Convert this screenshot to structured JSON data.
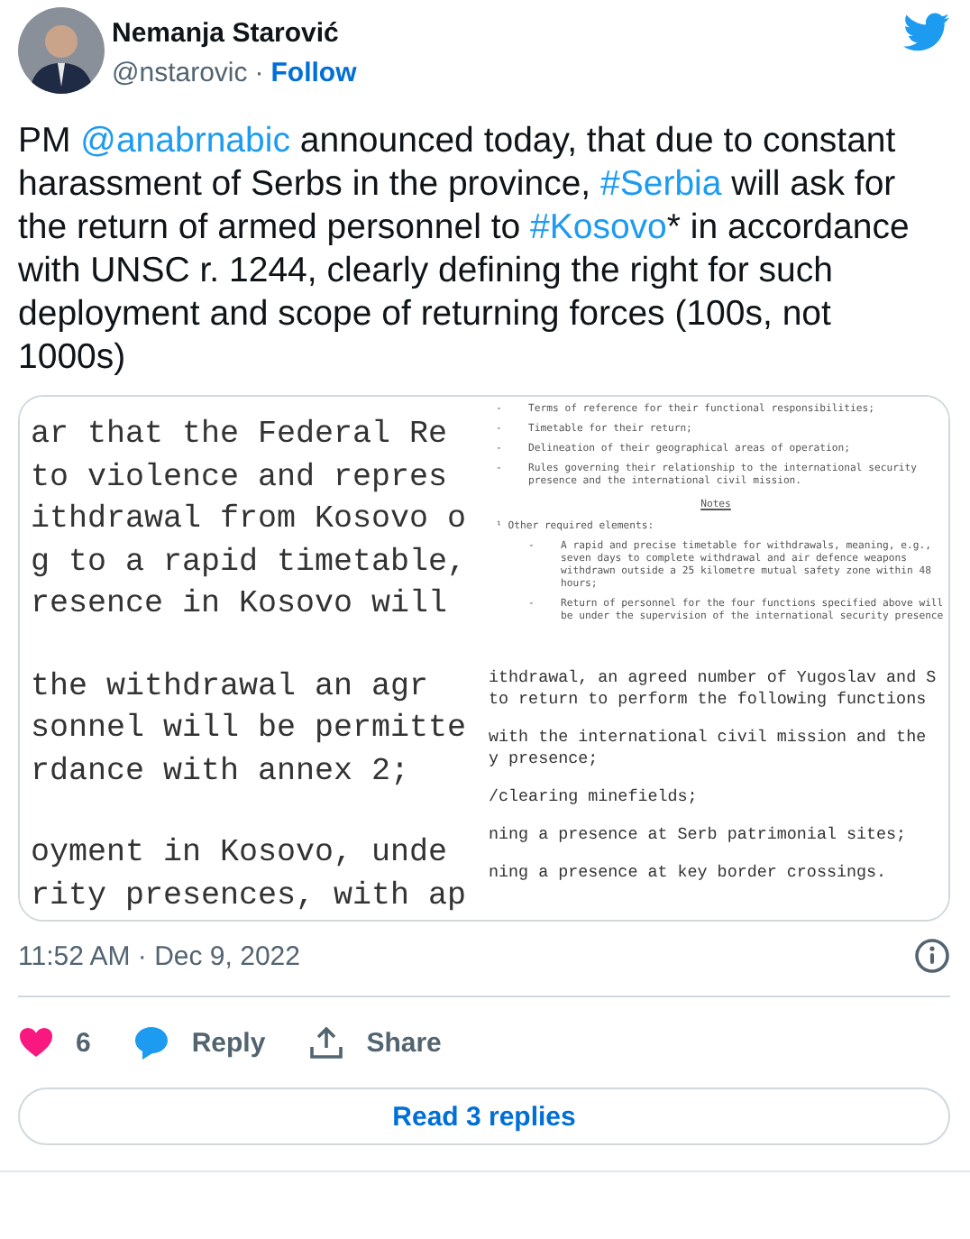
{
  "author": {
    "name": "Nemanja Starović",
    "handle": "@nstarovic",
    "separator": "·",
    "follow": "Follow"
  },
  "body": [
    {
      "kind": "text",
      "text": "PM "
    },
    {
      "kind": "link",
      "text": "@anabrnabic"
    },
    {
      "kind": "text",
      "text": " announced today, that due to constant harassment of Serbs in the province, "
    },
    {
      "kind": "link",
      "text": "#Serbia"
    },
    {
      "kind": "text",
      "text": " will ask for the return of armed personnel to "
    },
    {
      "kind": "link",
      "text": "#Kosovo"
    },
    {
      "kind": "text",
      "text": "* in accordance with UNSC r. 1244, clearly defining the right for such deployment and scope of returning forces (100s, not 1000s)"
    }
  ],
  "media": {
    "left": [
      [
        "ar that the Federal Re",
        "to violence and repres",
        "ithdrawal from Kosovo o",
        "g to a rapid timetable,",
        "resence in Kosovo will"
      ],
      [
        "the withdrawal an agr",
        "sonnel will be permitte",
        "rdance with annex 2;"
      ],
      [
        "oyment in Kosovo, unde",
        "rity presences, with ap"
      ]
    ],
    "right_top": [
      {
        "kind": "bullet",
        "marker": "-",
        "text": "Terms of reference for their functional responsibilities;"
      },
      {
        "kind": "bullet",
        "marker": "-",
        "text": "Timetable for their return;"
      },
      {
        "kind": "bullet",
        "marker": "-",
        "text": "Delineation of their geographical areas of operation;"
      },
      {
        "kind": "bullet",
        "marker": "-",
        "text": "Rules governing their relationship to the international security presence and the international civil mission."
      },
      {
        "kind": "heading",
        "text": "Notes"
      },
      {
        "kind": "text",
        "text": "¹ Other required elements:"
      },
      {
        "kind": "bullet",
        "marker": "-",
        "text": "A rapid and precise timetable for withdrawals, meaning, e.g., seven days to complete withdrawal and air defence weapons withdrawn outside a 25 kilometre mutual safety zone within 48 hours;"
      },
      {
        "kind": "bullet",
        "marker": "-",
        "text": "Return of personnel for the four functions specified above will be under the supervision of the international security presence"
      }
    ],
    "right_bottom": [
      [
        "ithdrawal, an agreed number of Yugoslav and S",
        "to return to perform the following functions"
      ],
      [
        "with the international civil mission and the",
        "y presence;"
      ],
      [
        "/clearing minefields;"
      ],
      [
        "ning a presence at Serb patrimonial sites;"
      ],
      [
        "ning a presence at key border crossings."
      ]
    ]
  },
  "timestamp": "11:52 AM · Dec 9, 2022",
  "actions": {
    "likes": "6",
    "reply": "Reply",
    "share": "Share"
  },
  "read_replies": "Read 3 replies"
}
